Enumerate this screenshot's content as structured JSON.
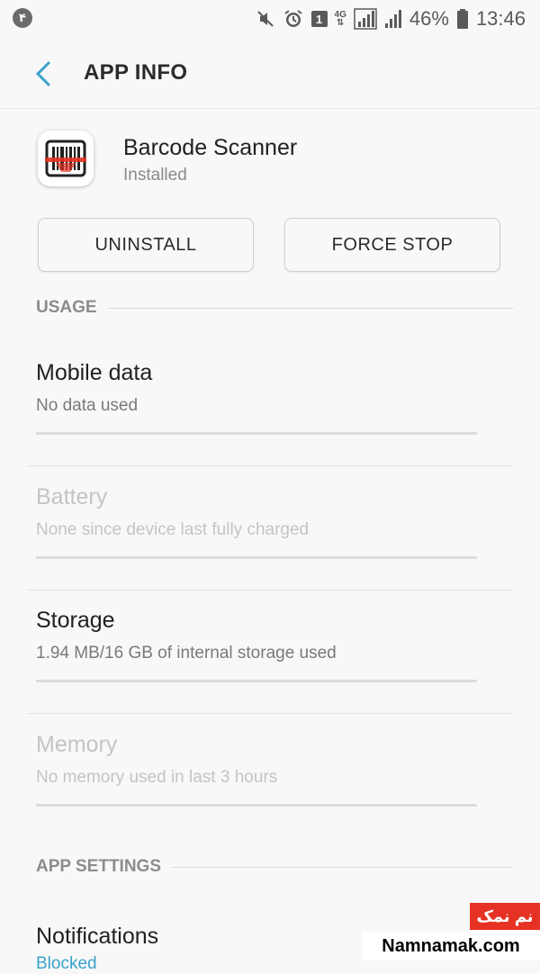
{
  "status_bar": {
    "notification_badge": "۴",
    "sim_badge": "1",
    "network_type": "4G",
    "battery_percent": "46%",
    "time": "13:46",
    "icons": [
      "mute-icon",
      "alarm-icon",
      "sim-badge",
      "signal-icon",
      "battery-icon"
    ]
  },
  "header": {
    "title": "APP INFO"
  },
  "app": {
    "name": "Barcode Scanner",
    "status": "Installed",
    "icon": "barcode-icon"
  },
  "buttons": {
    "uninstall": "UNINSTALL",
    "force_stop": "FORCE STOP"
  },
  "sections": {
    "usage": "USAGE",
    "app_settings": "APP SETTINGS"
  },
  "items": [
    {
      "title": "Mobile data",
      "subtitle": "No data used",
      "enabled": true
    },
    {
      "title": "Battery",
      "subtitle": "None since device last fully charged",
      "enabled": false
    },
    {
      "title": "Storage",
      "subtitle": "1.94 MB/16 GB of internal storage used",
      "enabled": true
    },
    {
      "title": "Memory",
      "subtitle": "No memory used in last 3 hours",
      "enabled": false
    }
  ],
  "notifications": {
    "title": "Notifications",
    "subtitle": "Blocked"
  },
  "watermark": {
    "brand_fa": "نم نمک",
    "brand": "Namnamak.com"
  },
  "colors": {
    "background": "#f8f8f8",
    "accent": "#3aa3c8",
    "watermark_red": "#e53224"
  }
}
